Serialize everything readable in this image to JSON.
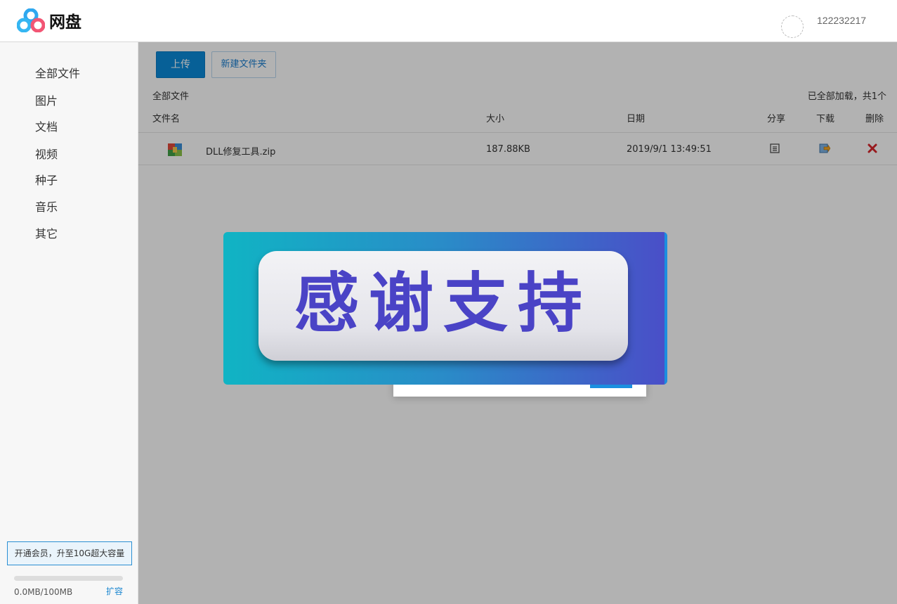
{
  "header": {
    "app_title": "网盘",
    "username": "122232217"
  },
  "sidebar": {
    "items": [
      {
        "label": "全部文件"
      },
      {
        "label": "图片"
      },
      {
        "label": "文档"
      },
      {
        "label": "视频"
      },
      {
        "label": "种子"
      },
      {
        "label": "音乐"
      },
      {
        "label": "其它"
      }
    ],
    "vip_label": "开通会员，升至10G超大容量",
    "storage_text": "0.0MB/100MB",
    "storage_used_fraction": 0.0,
    "expand_label": "扩容"
  },
  "toolbar": {
    "upload_label": "上传",
    "new_folder_label": "新建文件夹"
  },
  "main": {
    "breadcrumb": "全部文件",
    "loaded_status": "已全部加载，共1个",
    "columns": {
      "name": "文件名",
      "size": "大小",
      "date": "日期",
      "share": "分享",
      "download": "下载",
      "delete": "删除"
    },
    "files": [
      {
        "name": "DLL修复工具.zip",
        "size": "187.88KB",
        "date": "2019/9/1 13:49:51",
        "icon": "zip-archive-icon"
      }
    ]
  },
  "banner": {
    "text": "感谢支持"
  },
  "colors": {
    "accent": "#0b8ad8",
    "overlay": "rgba(0,0,0,0.3)",
    "banner_text": "#4a43c6",
    "delete_icon": "#d9262b"
  }
}
